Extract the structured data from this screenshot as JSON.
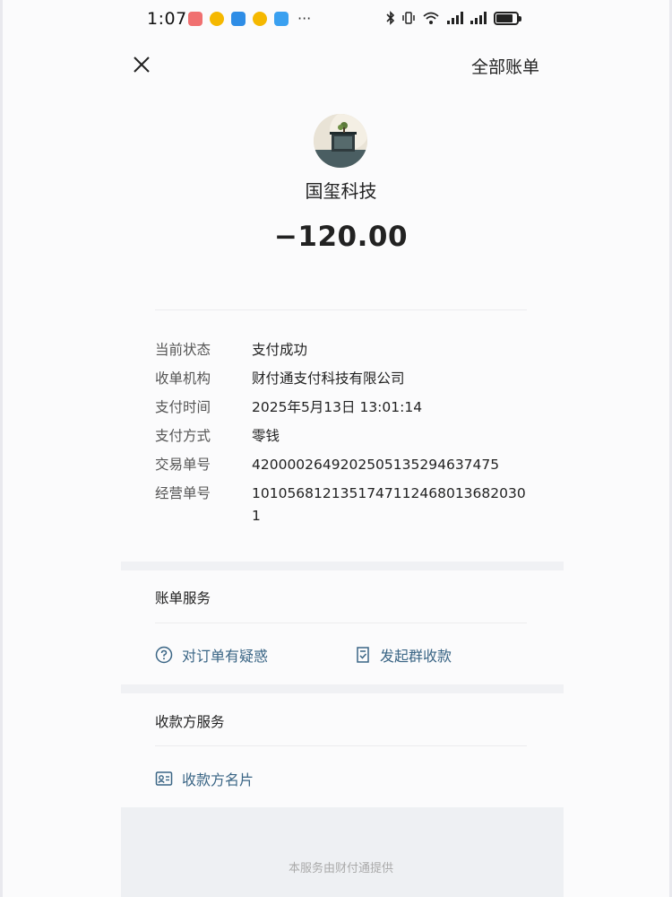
{
  "status_bar": {
    "time": "1:07",
    "more": "···"
  },
  "header": {
    "close_icon": "close-icon",
    "all_bills": "全部账单"
  },
  "merchant": {
    "name": "国玺科技",
    "amount": "−120.00"
  },
  "details": [
    {
      "key": "当前状态",
      "value": "支付成功"
    },
    {
      "key": "收单机构",
      "value": "财付通支付科技有限公司"
    },
    {
      "key": "支付时间",
      "value": "2025年5月13日 13:01:14"
    },
    {
      "key": "支付方式",
      "value": "零钱"
    },
    {
      "key": "交易单号",
      "value": "4200002649202505135294637475"
    },
    {
      "key": "经营单号",
      "value": "1010568121351747112468013682030 1"
    }
  ],
  "bill_service": {
    "title": "账单服务",
    "actions": [
      {
        "icon": "question-circle-icon",
        "label": "对订单有疑惑"
      },
      {
        "icon": "receipt-icon",
        "label": "发起群收款"
      }
    ]
  },
  "payee_service": {
    "title": "收款方服务",
    "actions": [
      {
        "icon": "contact-card-icon",
        "label": "收款方名片"
      }
    ]
  },
  "footer": {
    "text": "本服务由财付通提供"
  },
  "colors": {
    "link": "#3a6585",
    "background": "#fbfbfc",
    "band": "#f0f1f4"
  }
}
